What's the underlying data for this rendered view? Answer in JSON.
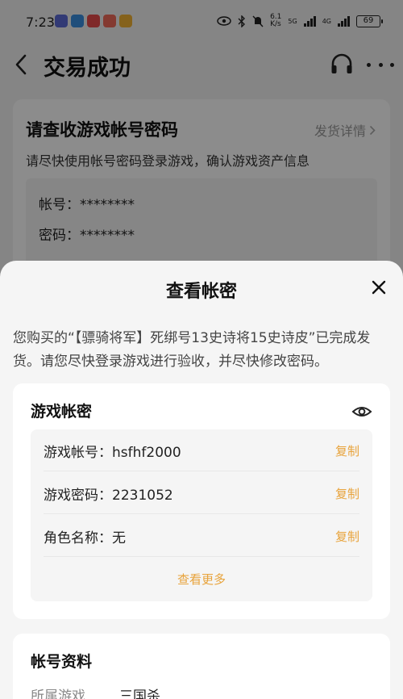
{
  "status_bar": {
    "time": "7:23",
    "network_speed": "6.1\nK/s",
    "net_5g": "5G",
    "net_4g": "4G",
    "battery": "69"
  },
  "nav": {
    "title": "交易成功"
  },
  "background_card": {
    "title": "请查收游戏帐号密码",
    "link_label": "发货详情",
    "subtitle": "请尽快使用帐号密码登录游戏，确认游戏资产信息",
    "account_label": "帐号：",
    "account_value": "********",
    "password_label": "密码：",
    "password_value": "********"
  },
  "sheet": {
    "title": "查看帐密",
    "message": "您购买的“【骠骑将军】死绑号13史诗将15史诗皮”已完成发货。请您尽快登录游戏进行验收，并尽快修改密码。",
    "credentials": {
      "title": "游戏帐密",
      "items": [
        {
          "label": "游戏帐号：hsfhf2000",
          "copy": "复制"
        },
        {
          "label": "游戏密码：2231052",
          "copy": "复制"
        },
        {
          "label": "角色名称：无",
          "copy": "复制"
        }
      ],
      "see_more": "查看更多"
    },
    "account_info": {
      "title": "帐号资料",
      "game_key": "所属游戏",
      "game_value": "三国杀"
    }
  },
  "colors": {
    "accent": "#e8a33b",
    "sheet_bg": "#f5f5f5",
    "card_bg": "#ffffff"
  }
}
